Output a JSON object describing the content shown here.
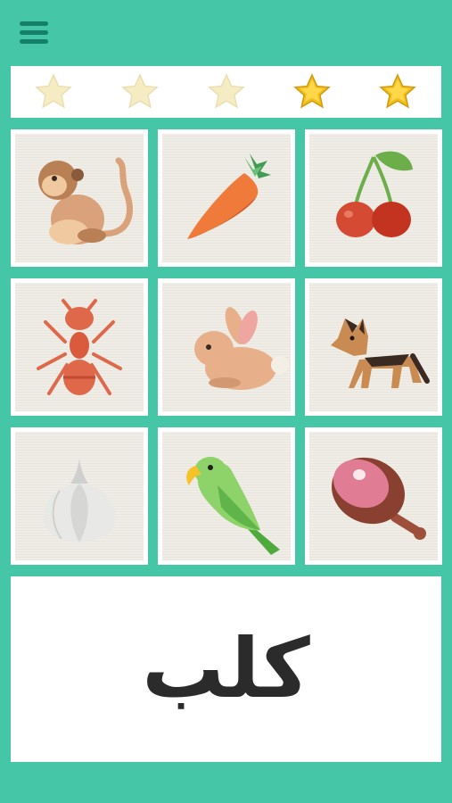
{
  "header": {
    "menu_icon": "hamburger-menu-icon"
  },
  "rating": {
    "total": 5,
    "filled": 2,
    "stars": [
      {
        "state": "empty",
        "icon": "star-icon"
      },
      {
        "state": "empty",
        "icon": "star-icon"
      },
      {
        "state": "empty",
        "icon": "star-icon"
      },
      {
        "state": "filled",
        "icon": "star-icon"
      },
      {
        "state": "filled",
        "icon": "star-icon"
      }
    ]
  },
  "tiles": [
    {
      "icon": "monkey-icon"
    },
    {
      "icon": "carrot-icon"
    },
    {
      "icon": "cherries-icon"
    },
    {
      "icon": "ant-icon"
    },
    {
      "icon": "rabbit-icon"
    },
    {
      "icon": "dog-icon"
    },
    {
      "icon": "garlic-icon"
    },
    {
      "icon": "parrot-icon"
    },
    {
      "icon": "ham-icon"
    }
  ],
  "prompt": {
    "word": "كلب"
  },
  "colors": {
    "background": "#45c6a6",
    "menu": "#14806a",
    "star_filled": "#f2c01c",
    "star_empty": "#f6ecc4",
    "word_text": "#2b2b2b"
  }
}
